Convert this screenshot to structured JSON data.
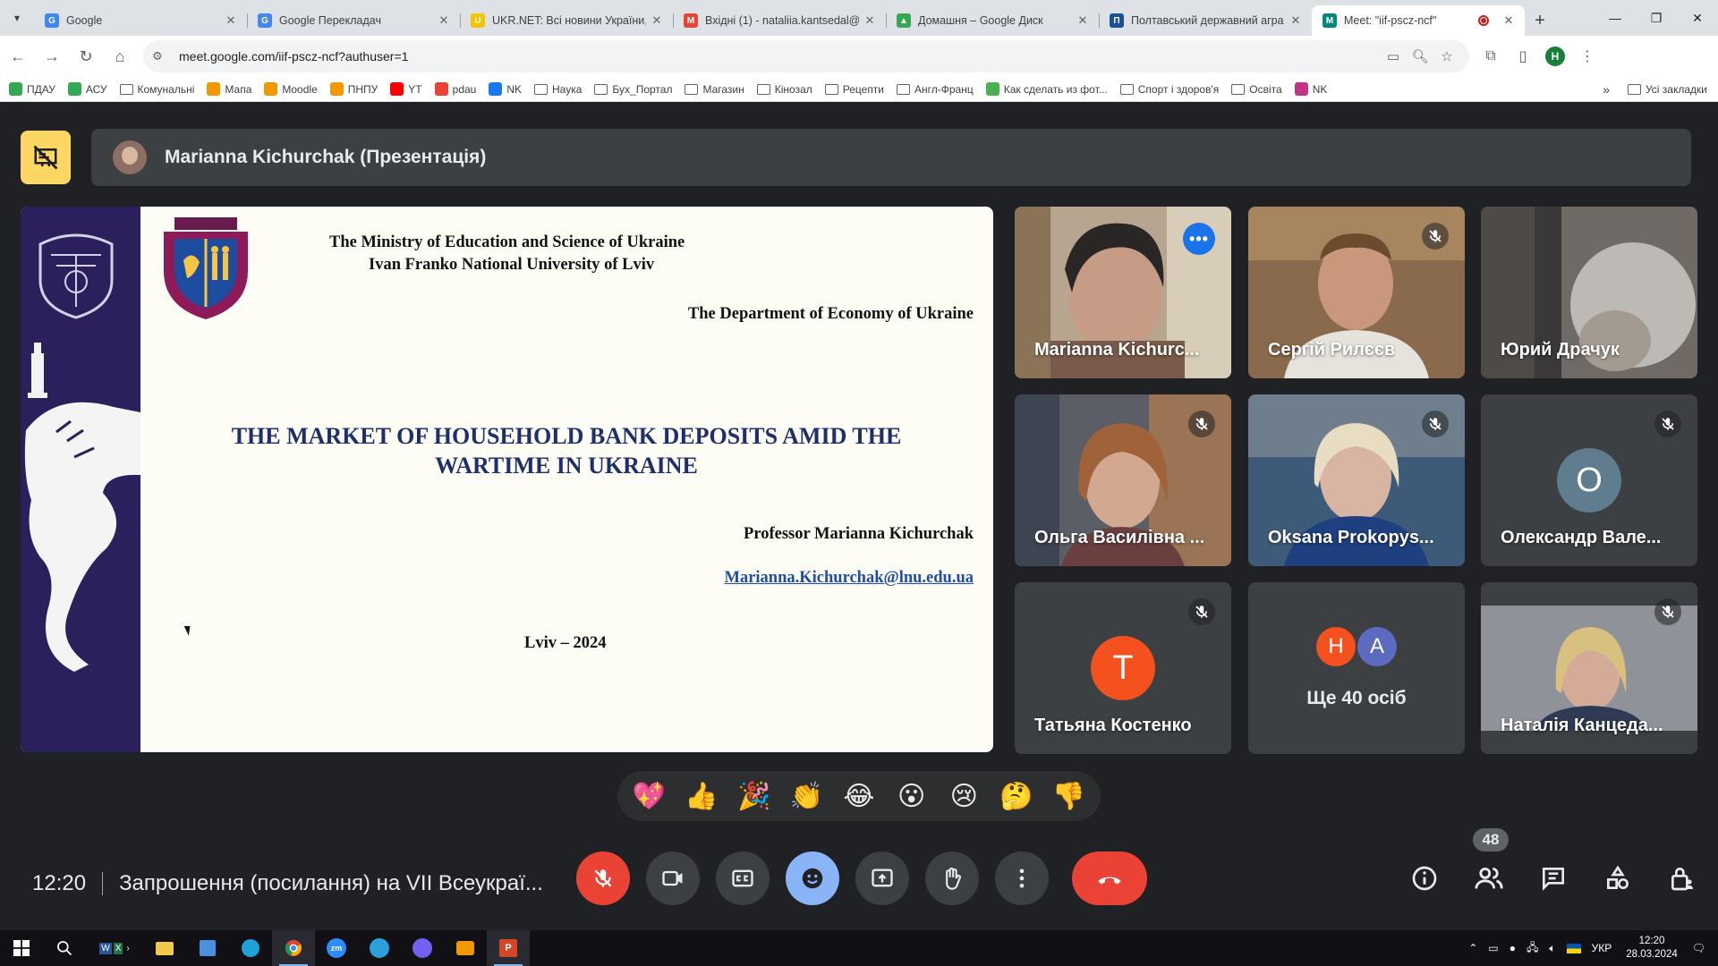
{
  "browser": {
    "tabs": [
      {
        "title": "Google",
        "fav": "G",
        "color": "#4285f4"
      },
      {
        "title": "Google Перекладач",
        "fav": "G",
        "color": "#4285f4"
      },
      {
        "title": "UKR.NET: Всі новини України,",
        "fav": "U",
        "color": "#f5c400"
      },
      {
        "title": "Вхідні (1) - nataliia.kantsedal@",
        "fav": "M",
        "color": "#ea4335"
      },
      {
        "title": "Домашня – Google Диск",
        "fav": "▲",
        "color": "#34a853"
      },
      {
        "title": "Полтавський державний агра",
        "fav": "П",
        "color": "#1a4f9c"
      },
      {
        "title": "Meet: \"iif-pscz-ncf\"",
        "fav": "M",
        "color": "#00897b"
      }
    ],
    "url": "meet.google.com/iif-pscz-ncf?authuser=1",
    "profile_initial": "Н",
    "bookmarks": [
      {
        "label": "ПДАУ",
        "type": "icon",
        "color": "#34a853"
      },
      {
        "label": "АСУ",
        "type": "icon",
        "color": "#34a853"
      },
      {
        "label": "Комунальні",
        "type": "folder"
      },
      {
        "label": "Мапа",
        "type": "icon",
        "color": "#f29900"
      },
      {
        "label": "Moodle",
        "type": "icon",
        "color": "#f29900"
      },
      {
        "label": "ПНПУ",
        "type": "icon",
        "color": "#f29900"
      },
      {
        "label": "YT",
        "type": "icon",
        "color": "#ff0000"
      },
      {
        "label": "pdau",
        "type": "icon",
        "color": "#ea4335"
      },
      {
        "label": "NK",
        "type": "icon",
        "color": "#1877f2"
      },
      {
        "label": "Наука",
        "type": "folder"
      },
      {
        "label": "Бух_Портал",
        "type": "folder"
      },
      {
        "label": "Магазин",
        "type": "folder"
      },
      {
        "label": "Кінозал",
        "type": "folder"
      },
      {
        "label": "Рецепти",
        "type": "folder"
      },
      {
        "label": "Англ-Франц",
        "type": "folder"
      },
      {
        "label": "Как сделать из фот...",
        "type": "icon",
        "color": "#4caf50"
      },
      {
        "label": "Спорт і здоров'я",
        "type": "folder"
      },
      {
        "label": "Освіта",
        "type": "folder"
      },
      {
        "label": "NK",
        "type": "icon",
        "color": "#c13584"
      }
    ],
    "all_bookmarks_label": "Усі закладки",
    "bookmarks_more": "»"
  },
  "meet": {
    "presenter_label": "Marianna Kichurchak (Презентація)",
    "slide": {
      "ministry": "The Ministry of Education and Science of Ukraine",
      "university": "Ivan Franko National University of Lviv",
      "department": "The Department of Economy of Ukraine",
      "title_line1": "THE MARKET OF HOUSEHOLD BANK DEPOSITS AMID THE",
      "title_line2": "WARTIME IN UKRAINE",
      "author": "Professor Marianna Kichurchak",
      "email": "Marianna.Kichurchak@lnu.edu.ua",
      "place_year": "Lviv – 2024"
    },
    "participants": [
      {
        "name": "Marianna Kichurc...",
        "kind": "video"
      },
      {
        "name": "Сергій Рилєєв",
        "kind": "video"
      },
      {
        "name": "Юрий Драчук",
        "kind": "video"
      },
      {
        "name": "Ольга Василівна ...",
        "kind": "video"
      },
      {
        "name": "Oksana Prokopys...",
        "kind": "video"
      },
      {
        "name": "Олександр Вале...",
        "kind": "avatar",
        "initial": "O"
      },
      {
        "name": "Татьяна Костенко",
        "kind": "avatar",
        "initial": "T"
      },
      {
        "name": "Ще 40 осіб",
        "kind": "more",
        "initials": [
          "Н",
          "A"
        ]
      },
      {
        "name": "Наталія Канцеда...",
        "kind": "video"
      }
    ],
    "reactions": [
      "💖",
      "👍",
      "🎉",
      "👏",
      "😂",
      "😮",
      "😢",
      "🤔",
      "👎"
    ],
    "clock": "12:20",
    "meeting_title": "Запрошення (посилання) на VII Всеукраї...",
    "participant_count": "48",
    "colors": {
      "accent": "#8ab4f8",
      "danger": "#ea4335",
      "present": "#fdd663"
    }
  },
  "taskbar": {
    "lang": "УКР",
    "time": "12:20",
    "date": "28.03.2024"
  }
}
